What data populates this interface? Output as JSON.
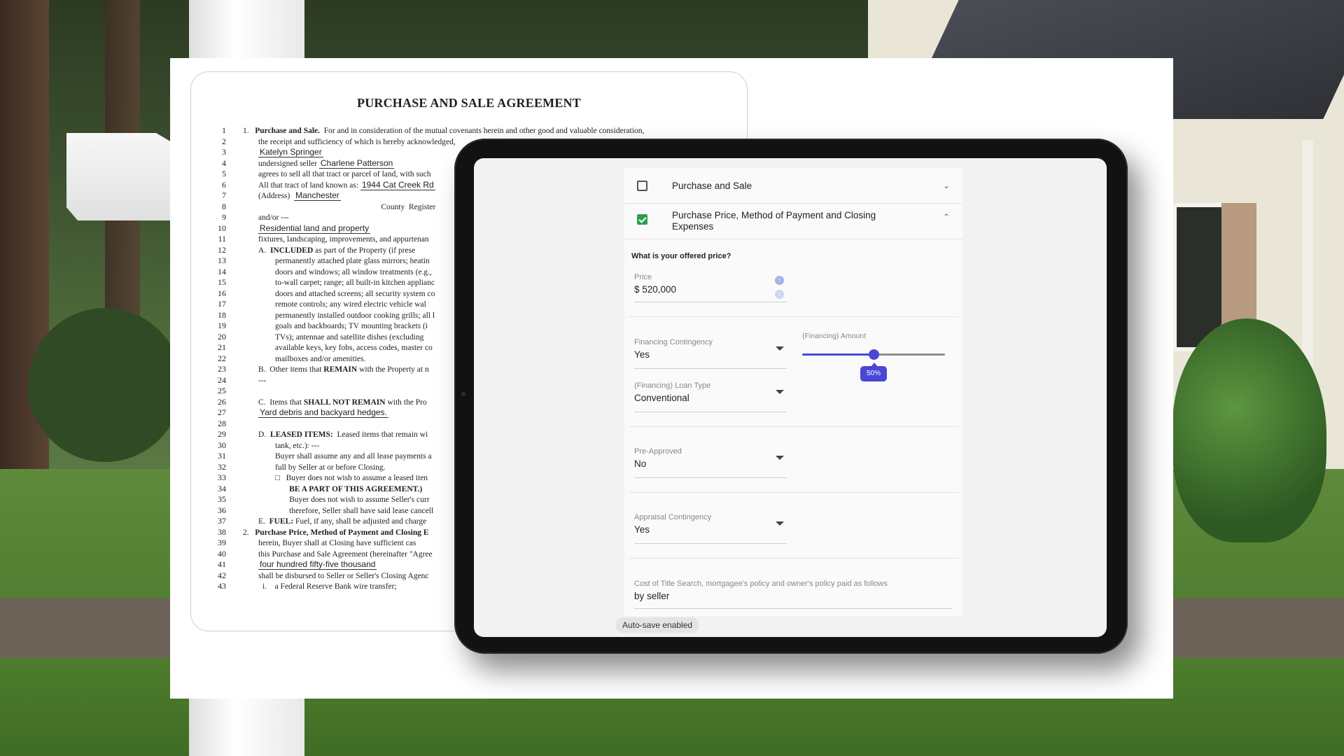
{
  "document": {
    "title": "PURCHASE AND SALE AGREEMENT",
    "lines": [
      {
        "n": "1",
        "segments": [
          {
            "t": "1.   "
          },
          {
            "t": "Purchase and Sale.",
            "b": true
          },
          {
            "t": "  For and in consideration of the mutual covenants herein and other good and valuable consideration,"
          }
        ],
        "indent": "ind1"
      },
      {
        "n": "2",
        "segments": [
          {
            "t": "the receipt and sufficiency of which is hereby acknowledged,"
          }
        ],
        "indent": "ind2"
      },
      {
        "n": "3",
        "segments": [
          {
            "t": "Katelyn Springer",
            "f": true
          }
        ],
        "indent": "ind2"
      },
      {
        "n": "4",
        "segments": [
          {
            "t": "undersigned seller "
          },
          {
            "t": "Charlene Patterson",
            "f": true
          }
        ],
        "indent": "ind2"
      },
      {
        "n": "5",
        "segments": [
          {
            "t": "agrees to sell all that tract or parcel of land, with such"
          }
        ],
        "indent": "ind2"
      },
      {
        "n": "6",
        "segments": [
          {
            "t": "All that tract of land known as: "
          },
          {
            "t": "1944 Cat Creek Rd",
            "f": true
          }
        ],
        "indent": "ind2"
      },
      {
        "n": "7",
        "segments": [
          {
            "t": "(Address)  "
          },
          {
            "t": "Manchester",
            "f": true
          }
        ],
        "indent": "ind2"
      },
      {
        "n": "8",
        "segments": [
          {
            "t": "                                                             County  Register"
          }
        ],
        "indent": "ind2"
      },
      {
        "n": "9",
        "segments": [
          {
            "t": "and/or ---"
          }
        ],
        "indent": "ind2"
      },
      {
        "n": "10",
        "segments": [
          {
            "t": "Residential land and property",
            "f": true
          }
        ],
        "indent": "ind2"
      },
      {
        "n": "11",
        "segments": [
          {
            "t": "fixtures, landscaping, improvements, and appurtenan"
          }
        ],
        "indent": "ind2"
      },
      {
        "n": "12",
        "segments": [
          {
            "t": "A.  "
          },
          {
            "t": "INCLUDED",
            "b": true
          },
          {
            "t": " as part of the Property (if prese"
          }
        ],
        "indent": "ind2"
      },
      {
        "n": "13",
        "segments": [
          {
            "t": "permanently attached plate glass mirrors; heatin"
          }
        ],
        "indent": "ind3"
      },
      {
        "n": "14",
        "segments": [
          {
            "t": "doors and windows; all window treatments (e.g.,"
          }
        ],
        "indent": "ind3"
      },
      {
        "n": "15",
        "segments": [
          {
            "t": "to-wall carpet; range; all built-in kitchen applianc"
          }
        ],
        "indent": "ind3"
      },
      {
        "n": "16",
        "segments": [
          {
            "t": "doors and attached screens; all security system co"
          }
        ],
        "indent": "ind3"
      },
      {
        "n": "17",
        "segments": [
          {
            "t": "remote controls; any wired electric vehicle wal"
          }
        ],
        "indent": "ind3"
      },
      {
        "n": "18",
        "segments": [
          {
            "t": "permanently installed outdoor cooking grills; all l"
          }
        ],
        "indent": "ind3"
      },
      {
        "n": "19",
        "segments": [
          {
            "t": "goals and backboards; TV mounting brackets (i"
          }
        ],
        "indent": "ind3"
      },
      {
        "n": "20",
        "segments": [
          {
            "t": "TVs); antennae and satellite dishes (excluding"
          }
        ],
        "indent": "ind3"
      },
      {
        "n": "21",
        "segments": [
          {
            "t": "available keys, key fobs, access codes, master co"
          }
        ],
        "indent": "ind3"
      },
      {
        "n": "22",
        "segments": [
          {
            "t": "mailboxes and/or amenities."
          }
        ],
        "indent": "ind3"
      },
      {
        "n": "23",
        "segments": [
          {
            "t": "B.  Other items that "
          },
          {
            "t": "REMAIN",
            "b": true
          },
          {
            "t": " with the Property at n"
          }
        ],
        "indent": "ind2"
      },
      {
        "n": "24",
        "segments": [
          {
            "t": "---"
          }
        ],
        "indent": "ind2"
      },
      {
        "n": "25",
        "segments": [
          {
            "t": ""
          }
        ],
        "indent": "ind2"
      },
      {
        "n": "26",
        "segments": [
          {
            "t": "C.  Items that "
          },
          {
            "t": "SHALL NOT REMAIN",
            "b": true
          },
          {
            "t": " with the Pro"
          }
        ],
        "indent": "ind2"
      },
      {
        "n": "27",
        "segments": [
          {
            "t": "Yard debris and backyard hedges.",
            "f": true
          }
        ],
        "indent": "ind2"
      },
      {
        "n": "28",
        "segments": [
          {
            "t": ""
          }
        ],
        "indent": "ind2"
      },
      {
        "n": "29",
        "segments": [
          {
            "t": "D.  "
          },
          {
            "t": "LEASED ITEMS:",
            "b": true
          },
          {
            "t": "  Leased items that remain wi"
          }
        ],
        "indent": "ind2"
      },
      {
        "n": "30",
        "segments": [
          {
            "t": "tank, etc.): ---"
          }
        ],
        "indent": "ind3"
      },
      {
        "n": "31",
        "segments": [
          {
            "t": "Buyer shall assume any and all lease payments a"
          }
        ],
        "indent": "ind3"
      },
      {
        "n": "32",
        "segments": [
          {
            "t": "full by Seller at or before Closing."
          }
        ],
        "indent": "ind3"
      },
      {
        "n": "33",
        "segments": [
          {
            "t": "□   Buyer does not wish to assume a leased iten"
          }
        ],
        "indent": "ind3"
      },
      {
        "n": "34",
        "segments": [
          {
            "t": "       "
          },
          {
            "t": "BE A PART OF THIS AGREEMENT.)",
            "b": true
          }
        ],
        "indent": "ind3"
      },
      {
        "n": "35",
        "segments": [
          {
            "t": "       Buyer does not wish to assume Seller's curr"
          }
        ],
        "indent": "ind3"
      },
      {
        "n": "36",
        "segments": [
          {
            "t": "       therefore, Seller shall have said lease cancell"
          }
        ],
        "indent": "ind3"
      },
      {
        "n": "37",
        "segments": [
          {
            "t": "E.  "
          },
          {
            "t": "FUEL:",
            "b": true
          },
          {
            "t": " Fuel, if any, shall be adjusted and charge"
          }
        ],
        "indent": "ind2"
      },
      {
        "n": "38",
        "segments": [
          {
            "t": "2.   "
          },
          {
            "t": "Purchase Price, Method of Payment and Closing E",
            "b": true
          }
        ],
        "indent": "ind1"
      },
      {
        "n": "39",
        "segments": [
          {
            "t": "herein, Buyer shall at Closing have sufficient cas"
          }
        ],
        "indent": "ind2"
      },
      {
        "n": "40",
        "segments": [
          {
            "t": "this Purchase and Sale Agreement (hereinafter \"Agree"
          }
        ],
        "indent": "ind2"
      },
      {
        "n": "41",
        "segments": [
          {
            "t": "four hundred fifty-five thousand",
            "f": true
          }
        ],
        "indent": "ind2"
      },
      {
        "n": "42",
        "segments": [
          {
            "t": "shall be disbursed to Seller or Seller's Closing Agenc"
          }
        ],
        "indent": "ind2"
      },
      {
        "n": "43",
        "segments": [
          {
            "t": "i.    a Federal Reserve Bank wire transfer;"
          }
        ],
        "indent": "ind4"
      }
    ]
  },
  "form": {
    "sections": [
      {
        "title": "Purchase and Sale",
        "checked": false,
        "chevron": "chevron-down-icon"
      },
      {
        "title": "Purchase Price, Method of Payment and Closing Expenses",
        "checked": true,
        "chevron": "chevron-up-icon"
      }
    ],
    "question": "What is your offered price?",
    "price": {
      "label": "Price",
      "value": "$ 520,000"
    },
    "financing_contingency": {
      "label": "Financing Contingency",
      "value": "Yes"
    },
    "loan_type": {
      "label": "(Financing) Loan Type",
      "value": "Conventional"
    },
    "financing_amount": {
      "label": "(Financing) Amount",
      "percent": 50,
      "display": "50%"
    },
    "pre_approved": {
      "label": "Pre-Approved",
      "value": "No"
    },
    "appraisal": {
      "label": "Appraisal Contingency",
      "value": "Yes"
    },
    "title_cost": {
      "label": "Cost of Title Search, mortgagee's policy and owner's policy paid as follows",
      "value": "by seller"
    }
  },
  "status": {
    "autosave": "Auto-save enabled"
  },
  "colors": {
    "accent": "#4a47d6",
    "checkbox_checked": "#2e9e4f",
    "chevron": "#4a67c7"
  }
}
